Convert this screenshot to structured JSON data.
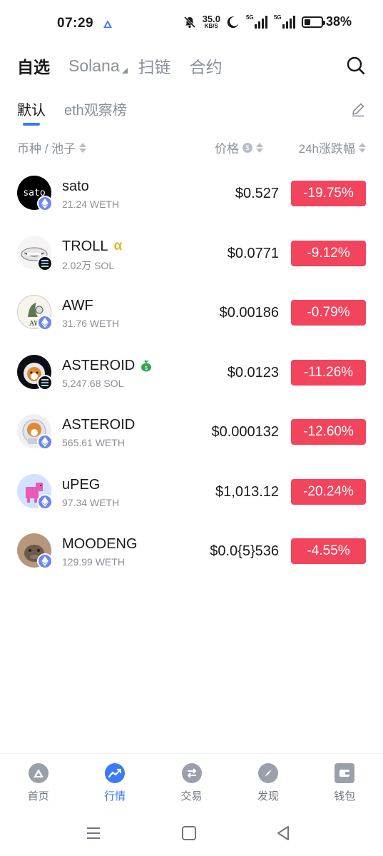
{
  "status_bar": {
    "time": "07:29",
    "net_speed_value": "35.0",
    "net_speed_unit": "KB/S",
    "signal1_tag": "5G",
    "signal2_tag": "5G",
    "battery_percent": 38,
    "battery_text": "38%"
  },
  "top_tabs": [
    {
      "label": "自选",
      "active": true
    },
    {
      "label": "Solana",
      "active": false
    },
    {
      "label": "扫链",
      "active": false
    },
    {
      "label": "合约",
      "active": false
    }
  ],
  "sub_tabs": [
    {
      "label": "默认",
      "active": true
    },
    {
      "label": "eth观察榜",
      "active": false
    }
  ],
  "columns": {
    "coin": "币种 / 池子",
    "price": "价格",
    "change": "24h涨跌幅"
  },
  "tokens": [
    {
      "name": "sato",
      "pool": "21.24 WETH",
      "price": "$0.527",
      "change": "-19.75%",
      "chain": "eth",
      "avatar_text": "sato"
    },
    {
      "name": "TROLL",
      "pool": "2.02万 SOL",
      "price": "$0.0771",
      "change": "-9.12%",
      "chain": "sol",
      "badge": "α"
    },
    {
      "name": "AWF",
      "pool": "31.76 WETH",
      "price": "$0.00186",
      "change": "-0.79%",
      "chain": "eth"
    },
    {
      "name": "ASTEROID",
      "pool": "5,247.68 SOL",
      "price": "$0.0123",
      "change": "-11.26%",
      "chain": "sol",
      "badge": "money-bag-icon"
    },
    {
      "name": "ASTEROID",
      "pool": "565.61 WETH",
      "price": "$0.000132",
      "change": "-12.60%",
      "chain": "eth"
    },
    {
      "name": "uPEG",
      "pool": "97.34 WETH",
      "price": "$1,013.12",
      "change": "-20.24%",
      "chain": "eth"
    },
    {
      "name": "MOODENG",
      "pool": "129.99 WETH",
      "price": "$0.0{5}536",
      "change": "-4.55%",
      "chain": "eth"
    }
  ],
  "bottom_nav": [
    {
      "label": "首页",
      "icon": "home-icon",
      "active": false
    },
    {
      "label": "行情",
      "icon": "market-icon",
      "active": true
    },
    {
      "label": "交易",
      "icon": "trade-icon",
      "active": false
    },
    {
      "label": "发现",
      "icon": "discover-icon",
      "active": false
    },
    {
      "label": "钱包",
      "icon": "wallet-icon",
      "active": false
    }
  ],
  "colors": {
    "accent": "#3b7bf6",
    "down": "#f2445d",
    "muted": "#8a8f99"
  }
}
